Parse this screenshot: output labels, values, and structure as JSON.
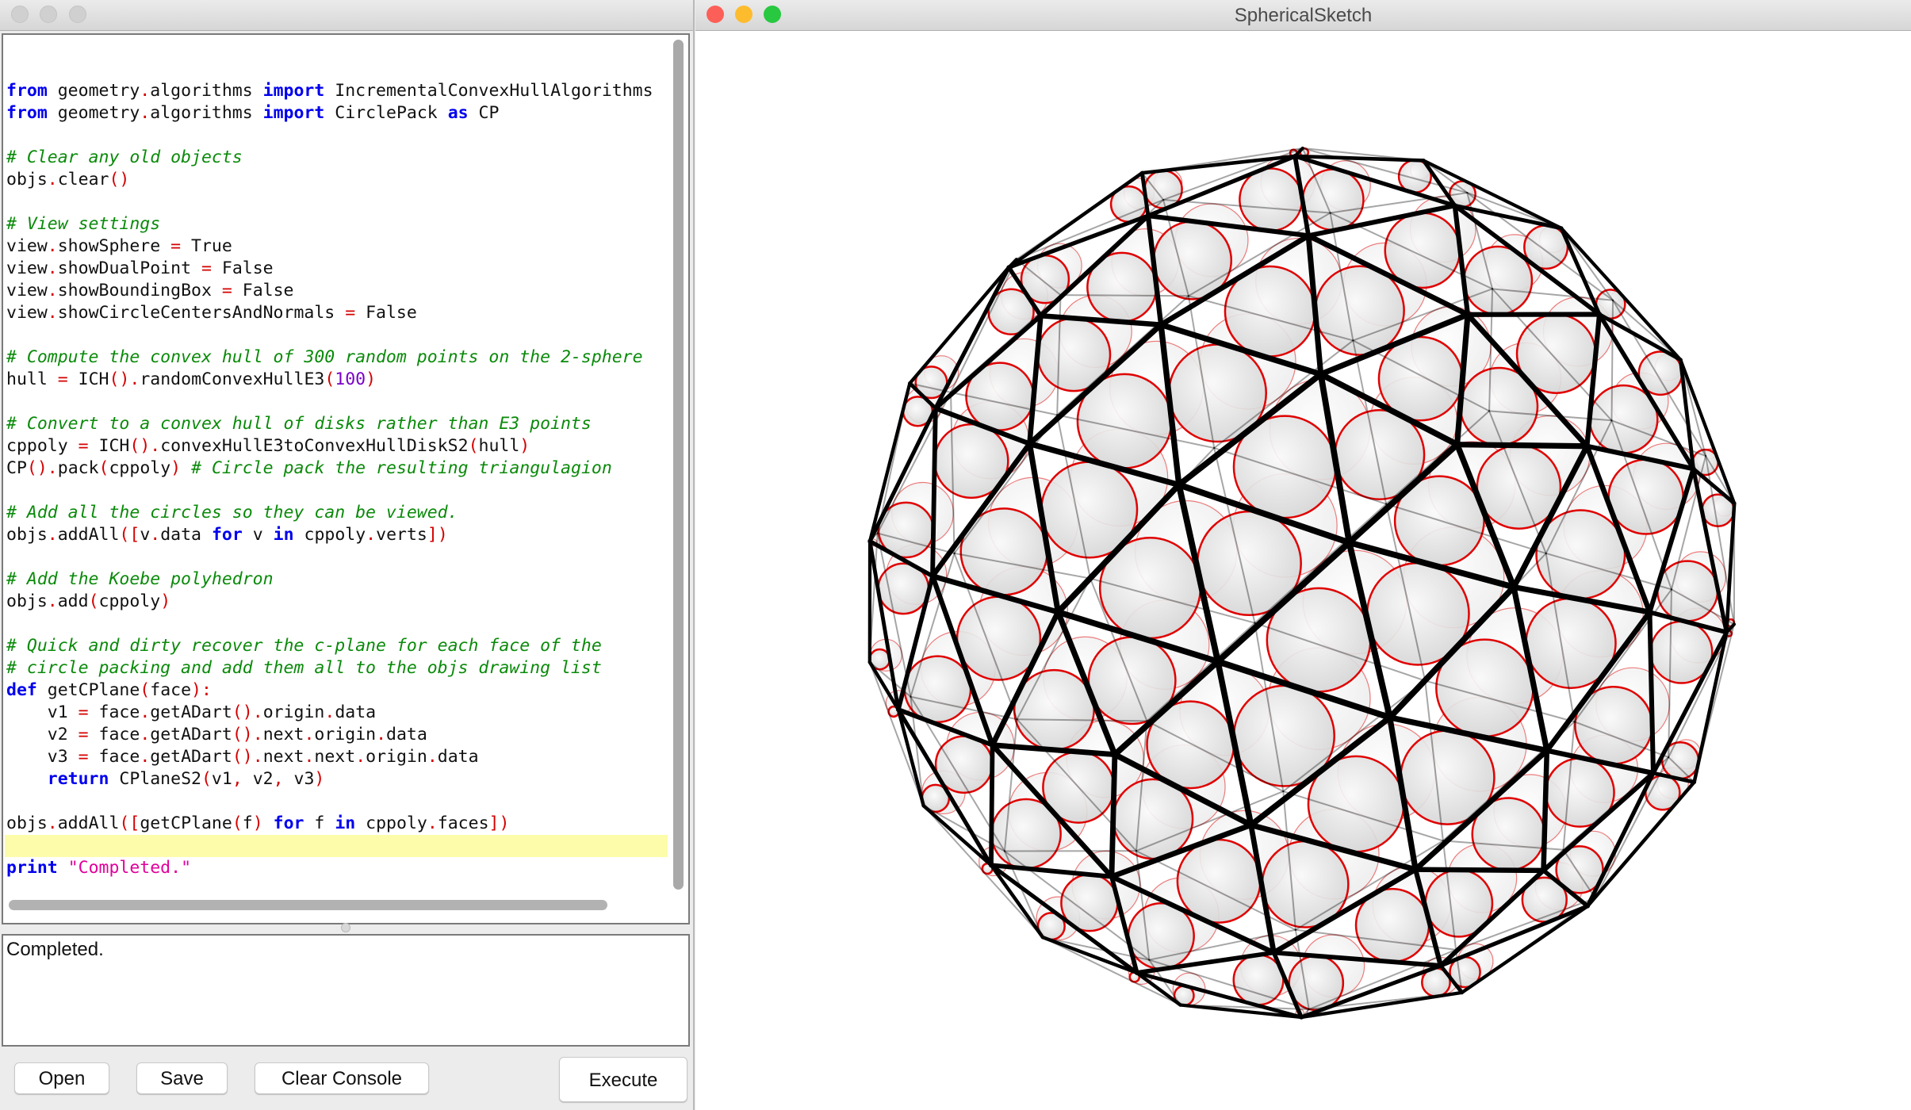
{
  "editor_window": {
    "code_lines": [
      "from geometry.algorithms import IncrementalConvexHullAlgorithms",
      "from geometry.algorithms import CirclePack as CP",
      "",
      "# Clear any old objects",
      "objs.clear()",
      "",
      "# View settings",
      "view.showSphere = True",
      "view.showDualPoint = False",
      "view.showBoundingBox = False",
      "view.showCircleCentersAndNormals = False",
      "",
      "# Compute the convex hull of 300 random points on the 2-sphere",
      "hull = ICH().randomConvexHullE3(100)",
      "",
      "# Convert to a convex hull of disks rather than E3 points",
      "cppoly = ICH().convexHullE3toConvexHullDiskS2(hull)",
      "CP().pack(cppoly) # Circle pack the resulting triangulagion",
      "",
      "# Add all the circles so they can be viewed.",
      "objs.addAll([v.data for v in cppoly.verts])",
      "",
      "# Add the Koebe polyhedron",
      "objs.add(cppoly)",
      "",
      "# Quick and dirty recover the c-plane for each face of the",
      "# circle packing and add them all to the objs drawing list",
      "def getCPlane(face):",
      "    v1 = face.getADart().origin.data",
      "    v2 = face.getADart().next.origin.data",
      "    v3 = face.getADart().next.next.origin.data",
      "    return CPlaneS2(v1, v2, v3)",
      "",
      "objs.addAll([getCPlane(f) for f in cppoly.faces])",
      "",
      "print \"Completed.\""
    ],
    "highlighted_line": 34,
    "console_output": "Completed.",
    "buttons": {
      "open": "Open",
      "save": "Save",
      "clear_console": "Clear Console",
      "execute": "Execute"
    }
  },
  "sketch_window": {
    "title": "SphericalSketch",
    "colors": {
      "edges": "#000000",
      "circles": "#e00000",
      "disk_fill": "#d6d6d6",
      "close": "#fc5f57",
      "minimize": "#fdbc2e",
      "zoom": "#28c840"
    }
  }
}
